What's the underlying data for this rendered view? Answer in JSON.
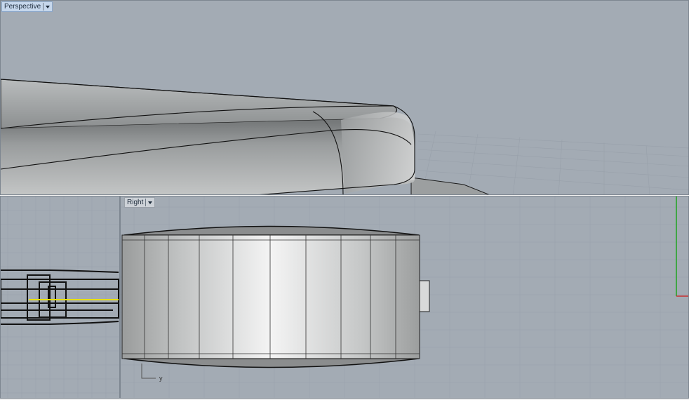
{
  "viewports": {
    "perspective": {
      "label": "Perspective"
    },
    "right": {
      "label": "Right",
      "axis_label": "y"
    }
  },
  "colors": {
    "viewport_background": "#a3abb4",
    "grid_line": "#98a0aa",
    "active_label_bg": "#c6d7ec",
    "y_axis_green": "#1fa51f",
    "x_axis_red": "#c83030",
    "curve_yellow": "#e8e000"
  },
  "icons": {
    "dropdown": "caret-down-icon"
  }
}
